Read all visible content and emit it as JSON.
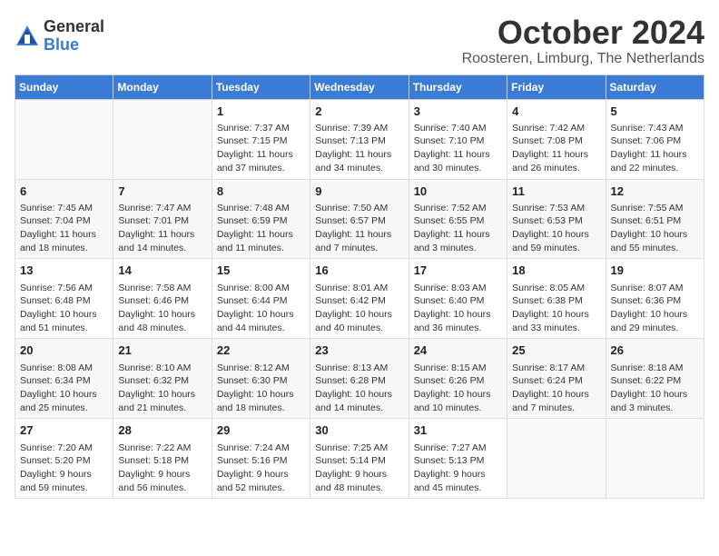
{
  "header": {
    "logo_general": "General",
    "logo_blue": "Blue",
    "title": "October 2024",
    "location": "Roosteren, Limburg, The Netherlands"
  },
  "weekdays": [
    "Sunday",
    "Monday",
    "Tuesday",
    "Wednesday",
    "Thursday",
    "Friday",
    "Saturday"
  ],
  "weeks": [
    [
      {
        "day": "",
        "info": ""
      },
      {
        "day": "",
        "info": ""
      },
      {
        "day": "1",
        "info": "Sunrise: 7:37 AM\nSunset: 7:15 PM\nDaylight: 11 hours and 37 minutes."
      },
      {
        "day": "2",
        "info": "Sunrise: 7:39 AM\nSunset: 7:13 PM\nDaylight: 11 hours and 34 minutes."
      },
      {
        "day": "3",
        "info": "Sunrise: 7:40 AM\nSunset: 7:10 PM\nDaylight: 11 hours and 30 minutes."
      },
      {
        "day": "4",
        "info": "Sunrise: 7:42 AM\nSunset: 7:08 PM\nDaylight: 11 hours and 26 minutes."
      },
      {
        "day": "5",
        "info": "Sunrise: 7:43 AM\nSunset: 7:06 PM\nDaylight: 11 hours and 22 minutes."
      }
    ],
    [
      {
        "day": "6",
        "info": "Sunrise: 7:45 AM\nSunset: 7:04 PM\nDaylight: 11 hours and 18 minutes."
      },
      {
        "day": "7",
        "info": "Sunrise: 7:47 AM\nSunset: 7:01 PM\nDaylight: 11 hours and 14 minutes."
      },
      {
        "day": "8",
        "info": "Sunrise: 7:48 AM\nSunset: 6:59 PM\nDaylight: 11 hours and 11 minutes."
      },
      {
        "day": "9",
        "info": "Sunrise: 7:50 AM\nSunset: 6:57 PM\nDaylight: 11 hours and 7 minutes."
      },
      {
        "day": "10",
        "info": "Sunrise: 7:52 AM\nSunset: 6:55 PM\nDaylight: 11 hours and 3 minutes."
      },
      {
        "day": "11",
        "info": "Sunrise: 7:53 AM\nSunset: 6:53 PM\nDaylight: 10 hours and 59 minutes."
      },
      {
        "day": "12",
        "info": "Sunrise: 7:55 AM\nSunset: 6:51 PM\nDaylight: 10 hours and 55 minutes."
      }
    ],
    [
      {
        "day": "13",
        "info": "Sunrise: 7:56 AM\nSunset: 6:48 PM\nDaylight: 10 hours and 51 minutes."
      },
      {
        "day": "14",
        "info": "Sunrise: 7:58 AM\nSunset: 6:46 PM\nDaylight: 10 hours and 48 minutes."
      },
      {
        "day": "15",
        "info": "Sunrise: 8:00 AM\nSunset: 6:44 PM\nDaylight: 10 hours and 44 minutes."
      },
      {
        "day": "16",
        "info": "Sunrise: 8:01 AM\nSunset: 6:42 PM\nDaylight: 10 hours and 40 minutes."
      },
      {
        "day": "17",
        "info": "Sunrise: 8:03 AM\nSunset: 6:40 PM\nDaylight: 10 hours and 36 minutes."
      },
      {
        "day": "18",
        "info": "Sunrise: 8:05 AM\nSunset: 6:38 PM\nDaylight: 10 hours and 33 minutes."
      },
      {
        "day": "19",
        "info": "Sunrise: 8:07 AM\nSunset: 6:36 PM\nDaylight: 10 hours and 29 minutes."
      }
    ],
    [
      {
        "day": "20",
        "info": "Sunrise: 8:08 AM\nSunset: 6:34 PM\nDaylight: 10 hours and 25 minutes."
      },
      {
        "day": "21",
        "info": "Sunrise: 8:10 AM\nSunset: 6:32 PM\nDaylight: 10 hours and 21 minutes."
      },
      {
        "day": "22",
        "info": "Sunrise: 8:12 AM\nSunset: 6:30 PM\nDaylight: 10 hours and 18 minutes."
      },
      {
        "day": "23",
        "info": "Sunrise: 8:13 AM\nSunset: 6:28 PM\nDaylight: 10 hours and 14 minutes."
      },
      {
        "day": "24",
        "info": "Sunrise: 8:15 AM\nSunset: 6:26 PM\nDaylight: 10 hours and 10 minutes."
      },
      {
        "day": "25",
        "info": "Sunrise: 8:17 AM\nSunset: 6:24 PM\nDaylight: 10 hours and 7 minutes."
      },
      {
        "day": "26",
        "info": "Sunrise: 8:18 AM\nSunset: 6:22 PM\nDaylight: 10 hours and 3 minutes."
      }
    ],
    [
      {
        "day": "27",
        "info": "Sunrise: 7:20 AM\nSunset: 5:20 PM\nDaylight: 9 hours and 59 minutes."
      },
      {
        "day": "28",
        "info": "Sunrise: 7:22 AM\nSunset: 5:18 PM\nDaylight: 9 hours and 56 minutes."
      },
      {
        "day": "29",
        "info": "Sunrise: 7:24 AM\nSunset: 5:16 PM\nDaylight: 9 hours and 52 minutes."
      },
      {
        "day": "30",
        "info": "Sunrise: 7:25 AM\nSunset: 5:14 PM\nDaylight: 9 hours and 48 minutes."
      },
      {
        "day": "31",
        "info": "Sunrise: 7:27 AM\nSunset: 5:13 PM\nDaylight: 9 hours and 45 minutes."
      },
      {
        "day": "",
        "info": ""
      },
      {
        "day": "",
        "info": ""
      }
    ]
  ]
}
